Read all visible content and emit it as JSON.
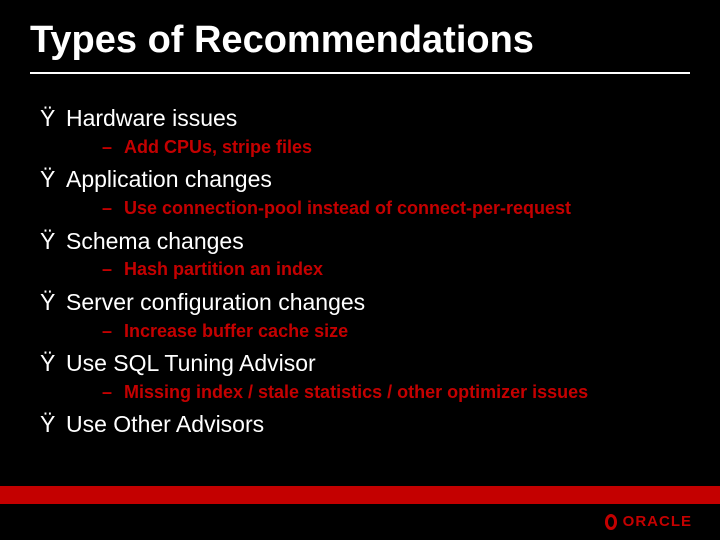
{
  "title": "Types of Recommendations",
  "bullets": {
    "b1": "Hardware issues",
    "b1s1": "Add CPUs, stripe files",
    "b2": "Application changes",
    "b2s1": "Use connection-pool instead of connect-per-request",
    "b3": "Schema changes",
    "b3s1": "Hash partition an index",
    "b4": "Server configuration changes",
    "b4s1": "Increase buffer cache size",
    "b5": "Use SQL Tuning Advisor",
    "b5s1": "Missing index / stale statistics / other optimizer issues",
    "b6": "Use Other Advisors"
  },
  "glyphs": {
    "l1": "Ÿ",
    "l2": "–"
  },
  "brand": {
    "name": "ORACLE",
    "accent": "#c40000"
  }
}
